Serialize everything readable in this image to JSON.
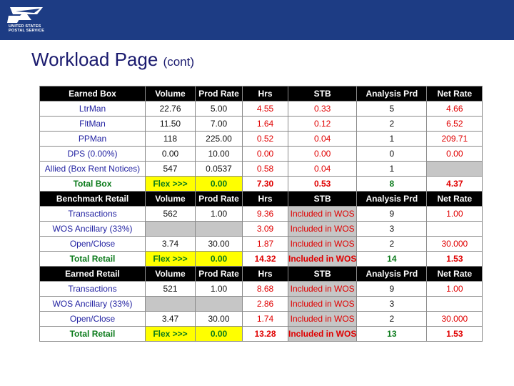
{
  "header": {
    "logo_line1": "UNITED STATES",
    "logo_line2": "POSTAL SERVICE"
  },
  "title": {
    "main": "Workload Page",
    "sub": "(cont)"
  },
  "sections": [
    {
      "columns": [
        "Earned Box",
        "Volume",
        "Prod Rate",
        "Hrs",
        "STB",
        "Analysis Prd",
        "Net Rate"
      ],
      "rows": [
        [
          "LtrMan",
          "22.76",
          "5.00",
          "4.55",
          "0.33",
          "5",
          "4.66"
        ],
        [
          "FltMan",
          "11.50",
          "7.00",
          "1.64",
          "0.12",
          "2",
          "6.52"
        ],
        [
          "PPMan",
          "118",
          "225.00",
          "0.52",
          "0.04",
          "1",
          "209.71"
        ],
        [
          "DPS (0.00%)",
          "0.00",
          "10.00",
          "0.00",
          "0.00",
          "0",
          "0.00"
        ],
        [
          "Allied (Box Rent Notices)",
          "547",
          "0.0537",
          "0.58",
          "0.04",
          "1",
          ""
        ]
      ],
      "total": [
        "Total Box",
        "Flex >>>",
        "0.00",
        "7.30",
        "0.53",
        "8",
        "4.37"
      ]
    },
    {
      "columns": [
        "Benchmark Retail",
        "Volume",
        "Prod Rate",
        "Hrs",
        "STB",
        "Analysis Prd",
        "Net Rate"
      ],
      "rows": [
        [
          "Transactions",
          "562",
          "1.00",
          "9.36",
          "Included in WOS",
          "9",
          "1.00"
        ],
        [
          "WOS Ancillary (33%)",
          "",
          "",
          "3.09",
          "Included in WOS",
          "3",
          ""
        ],
        [
          "Open/Close",
          "3.74",
          "30.00",
          "1.87",
          "Included in WOS",
          "2",
          "30.000"
        ]
      ],
      "total": [
        "Total Retail",
        "Flex >>>",
        "0.00",
        "14.32",
        "Included in WOS",
        "14",
        "1.53"
      ]
    },
    {
      "columns": [
        "Earned Retail",
        "Volume",
        "Prod Rate",
        "Hrs",
        "STB",
        "Analysis Prd",
        "Net Rate"
      ],
      "rows": [
        [
          "Transactions",
          "521",
          "1.00",
          "8.68",
          "Included in WOS",
          "9",
          "1.00"
        ],
        [
          "WOS Ancillary (33%)",
          "",
          "",
          "2.86",
          "Included in WOS",
          "3",
          ""
        ],
        [
          "Open/Close",
          "3.47",
          "30.00",
          "1.74",
          "Included in WOS",
          "2",
          "30.000"
        ]
      ],
      "total": [
        "Total Retail",
        "Flex >>>",
        "0.00",
        "13.28",
        "Included in WOS",
        "13",
        "1.53"
      ]
    }
  ]
}
